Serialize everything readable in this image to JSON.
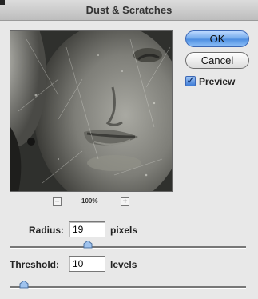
{
  "dialog": {
    "title": "Dust & Scratches"
  },
  "buttons": {
    "ok": "OK",
    "cancel": "Cancel"
  },
  "preview_toggle": {
    "label": "Preview",
    "checked": true
  },
  "zoom": {
    "minus": "−",
    "plus": "+",
    "level": "100%"
  },
  "radius": {
    "label": "Radius:",
    "value": "19",
    "unit": "pixels",
    "slider_fraction": 0.31
  },
  "threshold": {
    "label": "Threshold:",
    "value": "10",
    "unit": "levels",
    "slider_fraction": 0.04
  },
  "colors": {
    "ok_button": "#5d9be6",
    "checkbox": "#3d7bd6",
    "window_bg": "#e8e8e8"
  }
}
